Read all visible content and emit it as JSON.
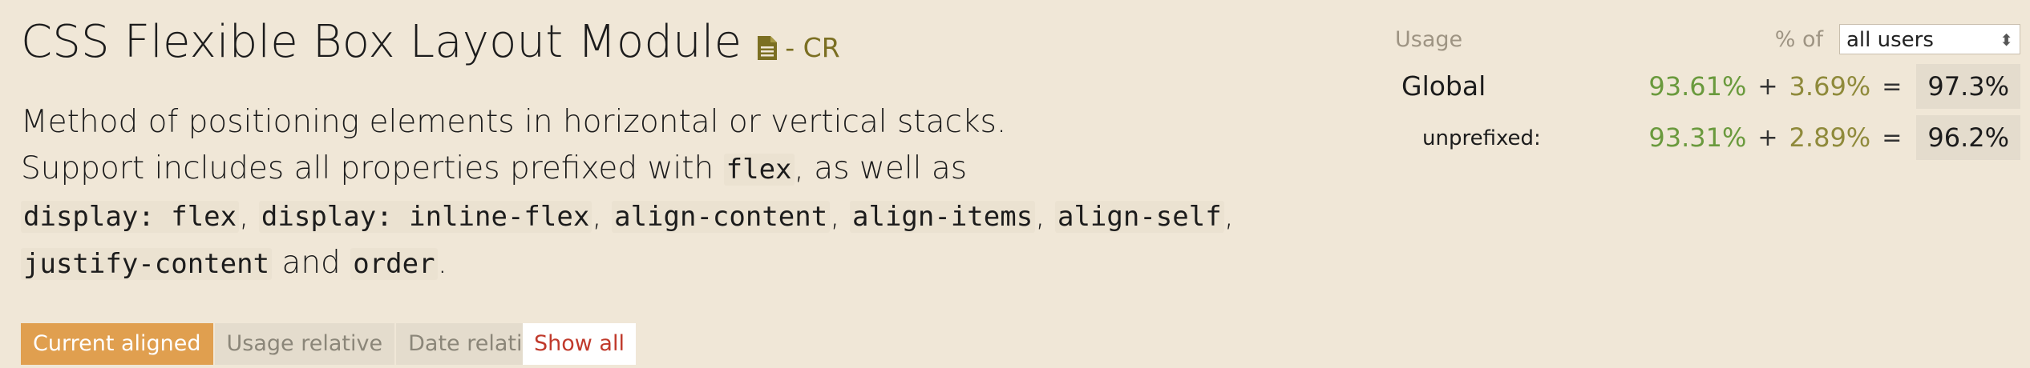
{
  "feature": {
    "title": "CSS Flexible Box Layout Module",
    "status": "- CR",
    "icon": "document-icon",
    "description": {
      "line1": "Method of positioning elements in horizontal or vertical stacks.",
      "support_intro": "Support includes all properties prefixed with ",
      "code_flex": "flex",
      "support_as_well": ", as well as",
      "code_display_flex": "display: flex",
      "comma1": ", ",
      "code_display_inline_flex": "display: inline-flex",
      "comma2": ", ",
      "code_align_content": "align-content",
      "comma3": ", ",
      "code_align_items": "align-items",
      "comma4": ", ",
      "code_align_self": "align-self",
      "comma5": ", ",
      "code_justify_content": "justify-content",
      "and": " and ",
      "code_order": "order",
      "period": "."
    }
  },
  "view_toggles": {
    "current_aligned": "Current aligned",
    "usage_relative": "Usage relative",
    "date_relative": "Date relative",
    "show_all": "Show all"
  },
  "usage": {
    "label": "Usage",
    "pct_of_label": "% of",
    "selected_users": "all users",
    "global": {
      "label": "Global",
      "full": "93.61%",
      "plus": "+",
      "partial": "3.69%",
      "equals": "=",
      "total": "97.3%"
    },
    "unprefixed": {
      "label": "unprefixed:",
      "full": "93.31%",
      "plus": "+",
      "partial": "2.89%",
      "equals": "=",
      "total": "96.2%"
    }
  },
  "colors": {
    "background": "#f0e7d7",
    "active_toggle": "#e09f4f",
    "full_support": "#6a9a3d",
    "partial_support": "#8f8a3b",
    "show_all_text": "#c0392b"
  }
}
